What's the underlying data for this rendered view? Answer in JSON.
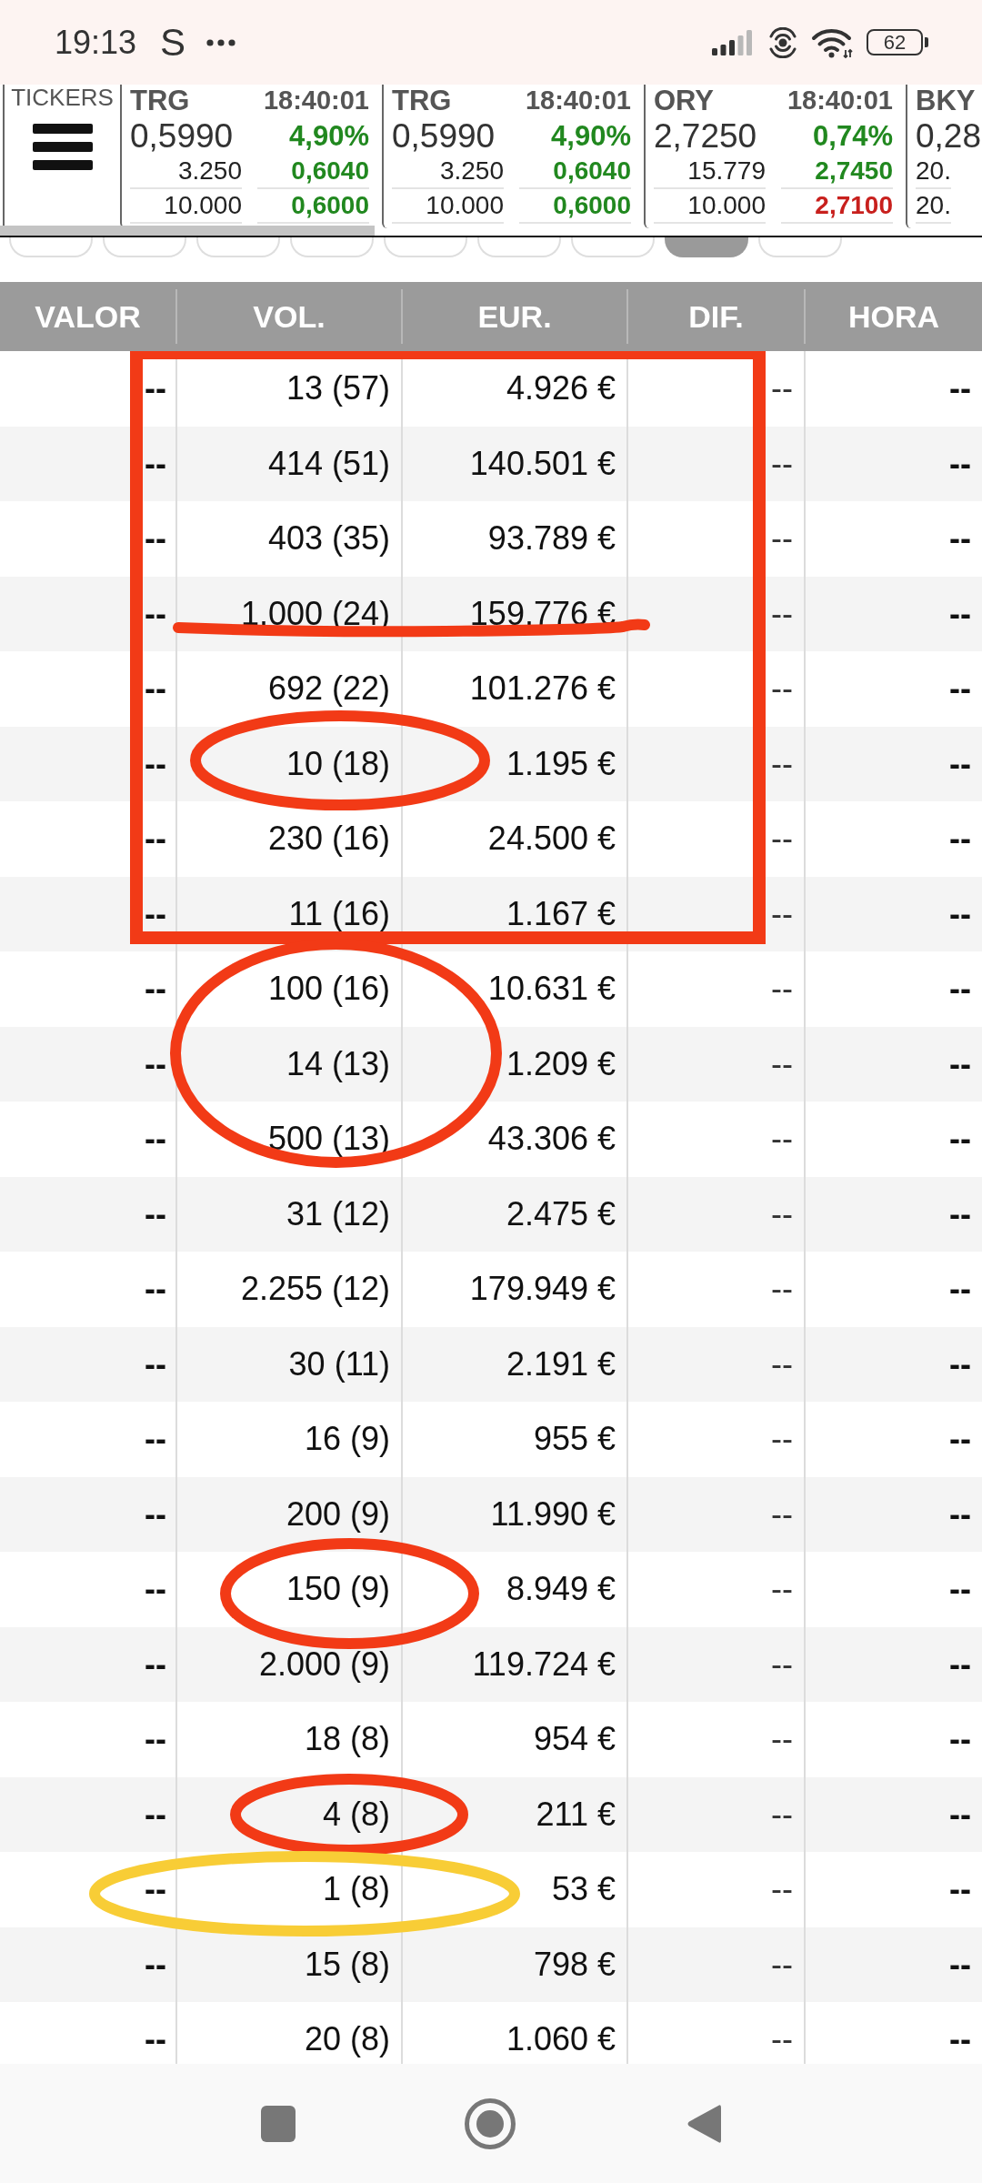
{
  "status_bar": {
    "time": "19:13",
    "notification_letter": "S",
    "battery": "62"
  },
  "tickers": {
    "label": "TICKERS",
    "items": [
      {
        "symbol": "TRG",
        "time": "18:40:01",
        "price": "0,5990",
        "change": {
          "value": "4,90%",
          "color": "#21881f"
        },
        "lines": [
          {
            "quantity": "3.250",
            "price": "0,6040",
            "color": "#21881f"
          },
          {
            "quantity": "10.000",
            "price": "0,6000",
            "color": "#21881f"
          }
        ]
      },
      {
        "symbol": "TRG",
        "time": "18:40:01",
        "price": "0,5990",
        "change": {
          "value": "4,90%",
          "color": "#21881f"
        },
        "lines": [
          {
            "quantity": "3.250",
            "price": "0,6040",
            "color": "#21881f"
          },
          {
            "quantity": "10.000",
            "price": "0,6000",
            "color": "#21881f"
          }
        ]
      },
      {
        "symbol": "ORY",
        "time": "18:40:01",
        "price": "2,7250",
        "change": {
          "value": "0,74%",
          "color": "#21881f"
        },
        "lines": [
          {
            "quantity": "15.779",
            "price": "2,7450",
            "color": "#21881f"
          },
          {
            "quantity": "10.000",
            "price": "2,7100",
            "color": "#c8201d"
          }
        ]
      },
      {
        "symbol": "BKY",
        "price": "0,28",
        "lines": [
          {
            "quantity": "20."
          },
          {
            "quantity": "20."
          }
        ]
      }
    ]
  },
  "filter_chips": [
    {
      "selected": false
    },
    {
      "selected": false
    },
    {
      "selected": false
    },
    {
      "selected": false
    },
    {
      "selected": false
    },
    {
      "selected": false
    },
    {
      "selected": false
    },
    {
      "selected": true
    },
    {
      "selected": false
    }
  ],
  "table": {
    "columns": [
      "VALOR",
      "VOL.",
      "EUR.",
      "DIF.",
      "HORA"
    ],
    "rows": [
      [
        "--",
        "13 (57)",
        "4.926 €",
        "--",
        "--"
      ],
      [
        "--",
        "414 (51)",
        "140.501 €",
        "--",
        "--"
      ],
      [
        "--",
        "403 (35)",
        "93.789 €",
        "--",
        "--"
      ],
      [
        "--",
        "1.000 (24)",
        "159.776 €",
        "--",
        "--"
      ],
      [
        "--",
        "692 (22)",
        "101.276 €",
        "--",
        "--"
      ],
      [
        "--",
        "10 (18)",
        "1.195 €",
        "--",
        "--"
      ],
      [
        "--",
        "230 (16)",
        "24.500 €",
        "--",
        "--"
      ],
      [
        "--",
        "11 (16)",
        "1.167 €",
        "--",
        "--"
      ],
      [
        "--",
        "100 (16)",
        "10.631 €",
        "--",
        "--"
      ],
      [
        "--",
        "14 (13)",
        "1.209 €",
        "--",
        "--"
      ],
      [
        "--",
        "500 (13)",
        "43.306 €",
        "--",
        "--"
      ],
      [
        "--",
        "31 (12)",
        "2.475 €",
        "--",
        "--"
      ],
      [
        "--",
        "2.255 (12)",
        "179.949 €",
        "--",
        "--"
      ],
      [
        "--",
        "30 (11)",
        "2.191 €",
        "--",
        "--"
      ],
      [
        "--",
        "16 (9)",
        "955 €",
        "--",
        "--"
      ],
      [
        "--",
        "200 (9)",
        "11.990 €",
        "--",
        "--"
      ],
      [
        "--",
        "150 (9)",
        "8.949 €",
        "--",
        "--"
      ],
      [
        "--",
        "2.000 (9)",
        "119.724 €",
        "--",
        "--"
      ],
      [
        "--",
        "18 (8)",
        "954 €",
        "--",
        "--"
      ],
      [
        "--",
        "4 (8)",
        "211 €",
        "--",
        "--"
      ],
      [
        "--",
        "1 (8)",
        "53 €",
        "--",
        "--"
      ],
      [
        "--",
        "15 (8)",
        "798 €",
        "--",
        "--"
      ],
      [
        "--",
        "20 (8)",
        "1.060 €",
        "--",
        "--"
      ]
    ]
  },
  "annotations": [
    {
      "kind": "rectangle",
      "color": "#f23a16"
    },
    {
      "kind": "strike",
      "color": "#f23a16"
    },
    {
      "kind": "ellipse",
      "color": "#f23a16"
    },
    {
      "kind": "ellipse",
      "color": "#f23a16"
    },
    {
      "kind": "ellipse",
      "color": "#f23a16"
    },
    {
      "kind": "ellipse",
      "color": "#f23a16"
    },
    {
      "kind": "ellipse",
      "color": "#f8cd36"
    }
  ]
}
